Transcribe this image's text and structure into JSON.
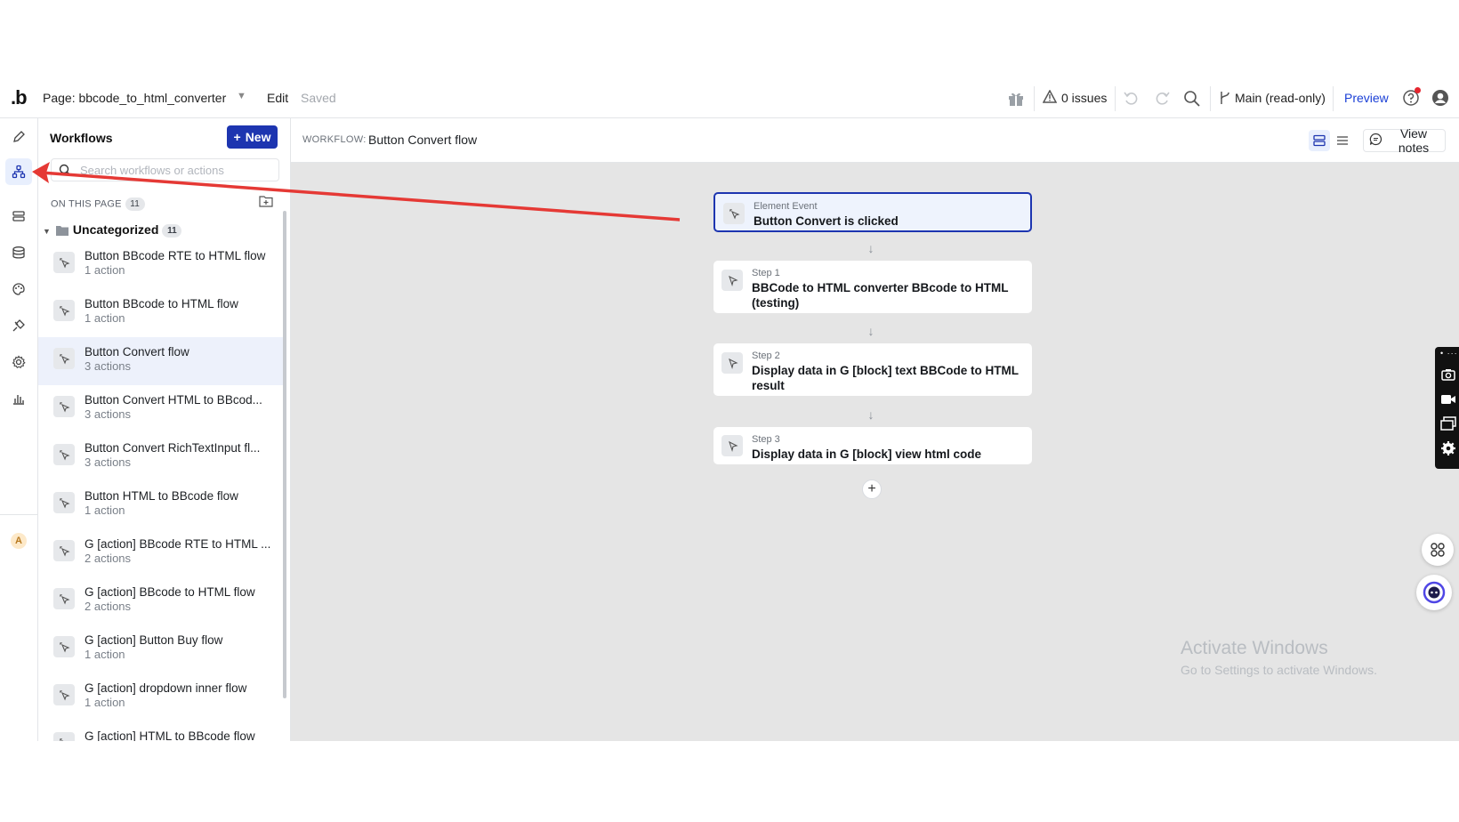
{
  "topbar": {
    "logo": ".b",
    "page_select": "Page: bbcode_to_html_converter",
    "edit": "Edit",
    "saved": "Saved",
    "issues": "0 issues",
    "branch": "Main (read-only)",
    "preview": "Preview"
  },
  "sidebar": {
    "title": "Workflows",
    "new_button": "New",
    "search_placeholder": "Search workflows or actions",
    "section_label": "ON THIS PAGE",
    "section_count": "11",
    "folder_name": "Uncategorized",
    "folder_count": "11",
    "workflows": [
      {
        "name": "Button BBcode RTE to HTML flow",
        "count": "1 action"
      },
      {
        "name": "Button BBcode to HTML flow",
        "count": "1 action"
      },
      {
        "name": "Button Convert flow",
        "count": "3 actions"
      },
      {
        "name": "Button Convert HTML to BBcod...",
        "count": "3 actions"
      },
      {
        "name": "Button Convert RichTextInput fl...",
        "count": "3 actions"
      },
      {
        "name": "Button HTML to BBcode flow",
        "count": "1 action"
      },
      {
        "name": "G [action] BBcode RTE to HTML ...",
        "count": "2 actions"
      },
      {
        "name": "G [action] BBcode to HTML flow",
        "count": "2 actions"
      },
      {
        "name": "G [action] Button Buy flow",
        "count": "1 action"
      },
      {
        "name": "G [action] dropdown inner flow",
        "count": "1 action"
      },
      {
        "name": "G [action] HTML to BBcode flow",
        "count": ""
      }
    ],
    "selected_index": 2
  },
  "main": {
    "workflow_label": "WORKFLOW:",
    "workflow_name": "Button Convert flow",
    "view_notes": "View notes",
    "event": {
      "kicker": "Element Event",
      "title": "Button Convert is clicked"
    },
    "steps": [
      {
        "kicker": "Step 1",
        "title": "BBCode to HTML converter BBcode to HTML (testing)"
      },
      {
        "kicker": "Step 2",
        "title": "Display data in G [block] text BBCode to HTML result"
      },
      {
        "kicker": "Step 3",
        "title": "Display data in G [block] view html code"
      }
    ],
    "add_step": "+",
    "watermark_title": "Activate Windows",
    "watermark_sub": "Go to Settings to activate Windows."
  },
  "rail": {
    "items": [
      "pencil-icon",
      "workflow-icon",
      "data-icon",
      "database-icon",
      "palette-icon",
      "plugin-icon",
      "settings-icon",
      "chart-icon"
    ],
    "active": "workflow-icon",
    "avatar_letter": "A"
  },
  "colors": {
    "accent": "#1d35b0",
    "annotation": "#e53935",
    "canvas": "#e5e5e5"
  }
}
